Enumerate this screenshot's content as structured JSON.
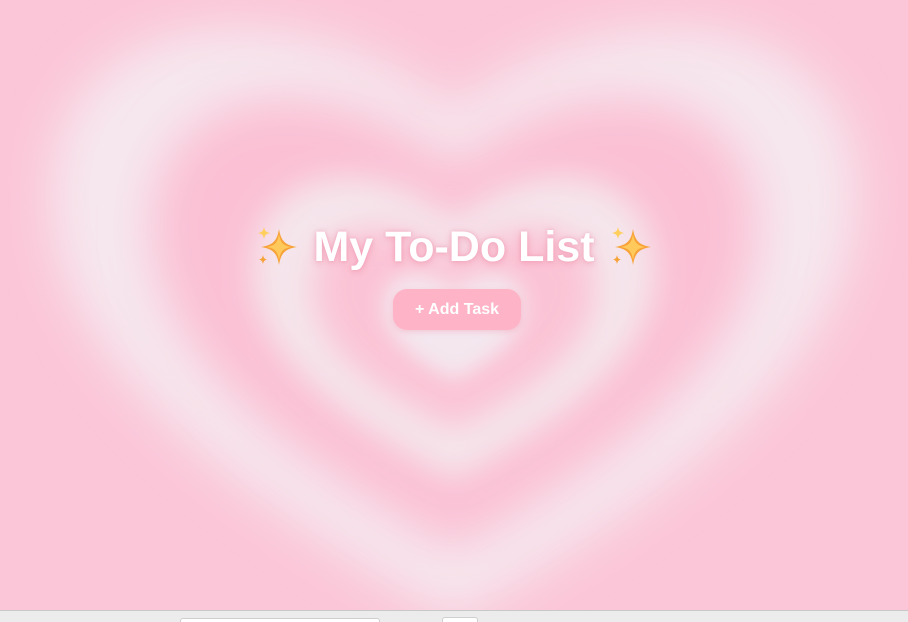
{
  "page": {
    "title": "My To-Do List",
    "sparkle_left": "sparkles-icon",
    "sparkle_right": "sparkles-icon"
  },
  "actions": {
    "add_task_label": "+ Add Task"
  },
  "colors": {
    "background_pink": "#fbc6d8",
    "background_light": "#f5e6ec",
    "button": "#ffb3c6",
    "title_text": "#ffffff"
  }
}
